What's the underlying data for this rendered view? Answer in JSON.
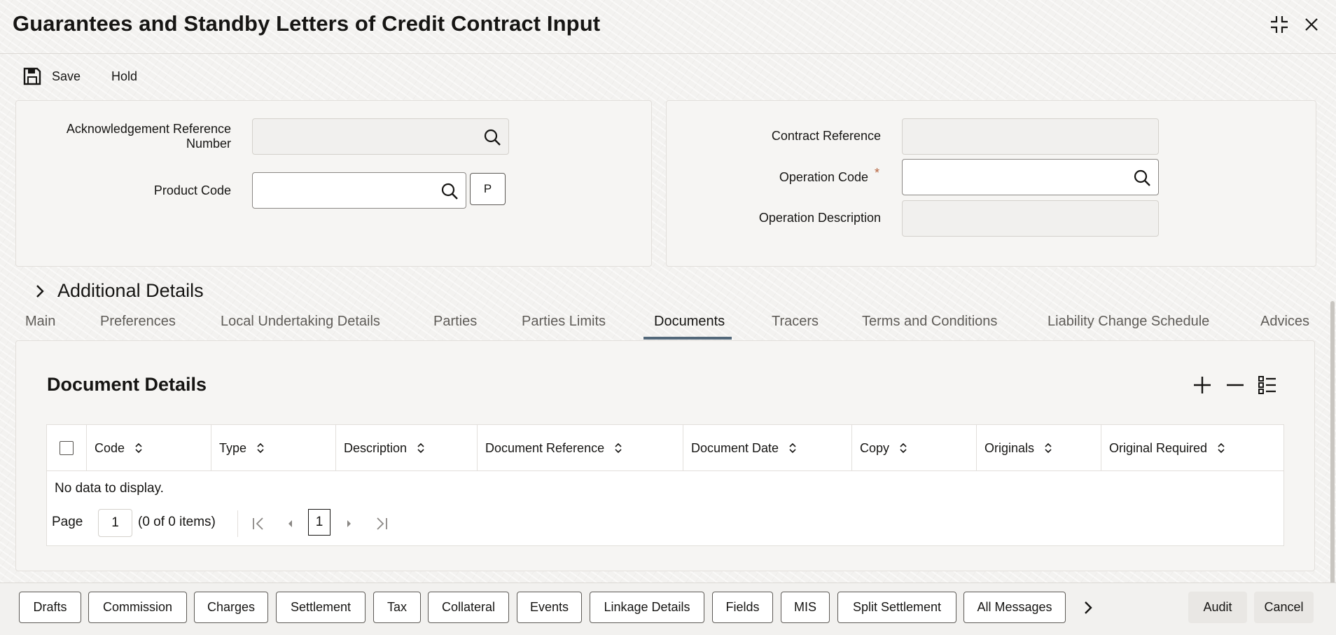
{
  "window": {
    "title": "Guarantees and Standby Letters of Credit Contract Input"
  },
  "toolbar": {
    "save_label": "Save",
    "hold_label": "Hold"
  },
  "header_left": {
    "ack_ref_label": "Acknowledgement Reference Number",
    "ack_ref_value": "",
    "product_code_label": "Product Code",
    "product_code_value": "",
    "p_button_label": "P"
  },
  "header_right": {
    "contract_ref_label": "Contract Reference",
    "contract_ref_value": "",
    "operation_code_label": "Operation Code",
    "operation_code_required": "*",
    "operation_code_value": "",
    "operation_desc_label": "Operation Description",
    "operation_desc_value": ""
  },
  "additional_details": {
    "label": "Additional Details"
  },
  "tabs": [
    {
      "label": "Main"
    },
    {
      "label": "Preferences"
    },
    {
      "label": "Local Undertaking Details"
    },
    {
      "label": "Parties"
    },
    {
      "label": "Parties Limits"
    },
    {
      "label": "Documents"
    },
    {
      "label": "Tracers"
    },
    {
      "label": "Terms and Conditions"
    },
    {
      "label": "Liability Change Schedule"
    },
    {
      "label": "Advices"
    }
  ],
  "active_tab": "Documents",
  "documents": {
    "title": "Document Details",
    "columns": [
      {
        "label": "Code"
      },
      {
        "label": "Type"
      },
      {
        "label": "Description"
      },
      {
        "label": "Document Reference"
      },
      {
        "label": "Document Date"
      },
      {
        "label": "Copy"
      },
      {
        "label": "Originals"
      },
      {
        "label": "Original Required"
      }
    ],
    "rows": [],
    "empty_text": "No data to display.",
    "pager": {
      "page_label": "Page",
      "page_value": "1",
      "items_text": "(0 of 0 items)",
      "current_page": "1"
    }
  },
  "footer_buttons": [
    {
      "label": "Drafts"
    },
    {
      "label": "Commission"
    },
    {
      "label": "Charges"
    },
    {
      "label": "Settlement"
    },
    {
      "label": "Tax"
    },
    {
      "label": "Collateral"
    },
    {
      "label": "Events"
    },
    {
      "label": "Linkage Details"
    },
    {
      "label": "Fields"
    },
    {
      "label": "MIS"
    },
    {
      "label": "Split Settlement"
    },
    {
      "label": "All Messages"
    }
  ],
  "footer_actions": {
    "audit_label": "Audit",
    "cancel_label": "Cancel"
  },
  "colors": {
    "active_tab_underline": "#53687a",
    "required_marker": "#b6633d"
  }
}
